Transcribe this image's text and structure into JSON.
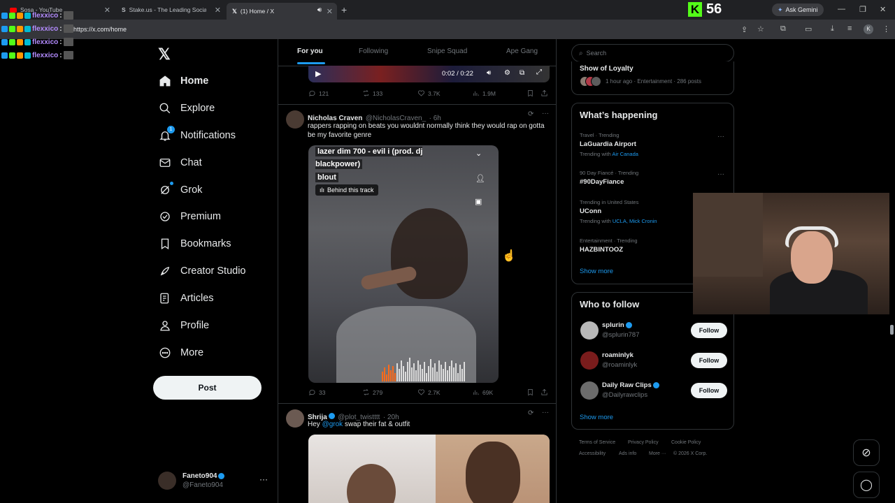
{
  "browser": {
    "tabs": [
      {
        "label": "Sosa - YouTube"
      },
      {
        "label": "Stake.us - The Leading Social C"
      },
      {
        "label": "(1) Home / X"
      }
    ],
    "url": "https://x.com/home",
    "overlay_count": "56",
    "gemini_label": "Ask Gemini",
    "profile_initial": "K"
  },
  "chat_overlay": [
    {
      "user": "flexxico",
      "suffix": " :"
    },
    {
      "user": "flexxico",
      "suffix": " :"
    },
    {
      "user": "flexxico",
      "suffix": " :"
    },
    {
      "user": "flexxico",
      "suffix": " :"
    }
  ],
  "nav": {
    "items": [
      {
        "label": "Home"
      },
      {
        "label": "Explore"
      },
      {
        "label": "Notifications",
        "badge": "1"
      },
      {
        "label": "Chat"
      },
      {
        "label": "Grok"
      },
      {
        "label": "Premium"
      },
      {
        "label": "Bookmarks"
      },
      {
        "label": "Creator Studio"
      },
      {
        "label": "Articles"
      },
      {
        "label": "Profile"
      },
      {
        "label": "More"
      }
    ],
    "post_label": "Post",
    "account": {
      "name": "Faneto904",
      "handle": "@Faneto904"
    }
  },
  "timeline": {
    "tabs": [
      {
        "label": "For you"
      },
      {
        "label": "Following"
      },
      {
        "label": "Snipe Squad"
      },
      {
        "label": "Ape Gang"
      }
    ],
    "first_post": {
      "video_time": "0:02 / 0:22",
      "replies": "121",
      "reposts": "133",
      "likes": "3.7K",
      "views": "1.9M"
    },
    "second_post": {
      "name": "Nicholas Craven",
      "handle": "@NicholasCraven_",
      "time": "· 6h",
      "text": "rappers rapping on beats you wouldnt normally think they would rap on gotta be my favorite genre",
      "track_title": "lazer dim 700 - evil i (prod. dj blackpower)",
      "track_artist": "blout",
      "behind_track": "Behind this track",
      "replies": "33",
      "reposts": "279",
      "likes": "2.7K",
      "views": "69K"
    },
    "third_post": {
      "name": "Shrija",
      "handle": "@plot_twistttt",
      "time": "· 20h",
      "text_prefix": "Hey ",
      "mention": "@grok",
      "text_suffix": " swap their fat & outfit"
    }
  },
  "sidebar": {
    "search_placeholder": "Search",
    "top_card": {
      "title": "Show of Loyalty",
      "meta": "1 hour ago · Entertainment · 286 posts"
    },
    "whats_happening": {
      "title": "What’s happening",
      "trends": [
        {
          "meta": "Travel · Trending",
          "name": "LaGuardia Airport",
          "with_prefix": "Trending with ",
          "with": "Air Canada"
        },
        {
          "meta": "90 Day Fiancé · Trending",
          "name": "#90DayFiance",
          "with_prefix": "",
          "with": ""
        },
        {
          "meta": "Trending in United States",
          "name": "UConn",
          "with_prefix": "Trending with ",
          "with": "UCLA, Mick Cronin"
        },
        {
          "meta": "Entertainment · Trending",
          "name": "HAZBINTOOZ",
          "with_prefix": "",
          "with": ""
        }
      ],
      "show_more": "Show more"
    },
    "who_to_follow": {
      "title": "Who to follow",
      "users": [
        {
          "name": "splurin",
          "handle": "@splurin787",
          "button": "Follow",
          "avatar_color": "#b8b8b8"
        },
        {
          "name": "roaminlyk",
          "handle": "@roaminlyk",
          "button": "Follow",
          "avatar_color": "#7a1c1c"
        },
        {
          "name": "Daily Raw Clips",
          "handle": "@Dailyrawclips",
          "button": "Follow",
          "avatar_color": "#6c6c6c"
        }
      ],
      "show_more": "Show more"
    },
    "footer": {
      "links": [
        "Terms of Service",
        "Privacy Policy",
        "Cookie Policy",
        "Accessibility",
        "Ads info",
        "More ···",
        "© 2026 X Corp."
      ]
    }
  },
  "colors": {
    "accent": "#1d9bf0",
    "background": "#000000",
    "border": "#2f3336",
    "muted": "#71767b",
    "overlay_green": "#53fc18"
  }
}
